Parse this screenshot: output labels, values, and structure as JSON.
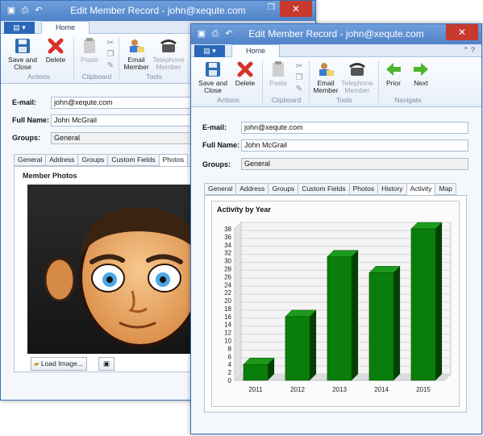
{
  "window_title": "Edit Member Record - john@xequte.com",
  "ribbon": {
    "tab": "Home",
    "save_label": "Save and\nClose",
    "delete_label": "Delete",
    "paste_label": "Paste",
    "email_label": "Email\nMember",
    "telephone_label": "Telephone\nMember",
    "prior_label": "Prior",
    "next_label": "Next",
    "groups": {
      "actions": "Actions",
      "clipboard": "Clipboard",
      "tools": "Tools",
      "navigate": "Navigate"
    }
  },
  "form": {
    "email_label": "E-mail:",
    "email_value": "john@xequte.com",
    "fullname_label": "Full Name:",
    "fullname_value": "John McGrail",
    "groups_label": "Groups:",
    "groups_value": "General"
  },
  "back_tabs": [
    "General",
    "Address",
    "Groups",
    "Custom Fields",
    "Photos"
  ],
  "front_tabs": [
    "General",
    "Address",
    "Groups",
    "Custom Fields",
    "Photos",
    "History",
    "Activity",
    "Map"
  ],
  "photos": {
    "title": "Member Photos",
    "load_button": "Load Image..."
  },
  "icons": {
    "save": "floppy-disk-icon",
    "delete": "red-x-icon",
    "paste": "clipboard-icon",
    "email": "person-email-icon",
    "telephone": "telephone-icon",
    "prior": "green-left-arrow-icon",
    "next": "green-right-arrow-icon"
  },
  "colors": {
    "titlebar": "#5a8ad0",
    "close": "#c7392c",
    "bar": "#0a7e0a",
    "bar_top": "#1c9a1c",
    "bar_side": "#053f05"
  },
  "chart_data": {
    "type": "bar",
    "title": "Activity by Year",
    "categories": [
      "2011",
      "2012",
      "2013",
      "2014",
      "2015"
    ],
    "values": [
      4,
      16,
      31,
      27,
      38
    ],
    "ylim": [
      0,
      38
    ],
    "yticks": [
      0,
      2,
      4,
      6,
      8,
      10,
      12,
      14,
      16,
      18,
      20,
      22,
      24,
      26,
      28,
      30,
      32,
      34,
      36,
      38
    ],
    "grid": true,
    "xlabel": "",
    "ylabel": ""
  }
}
